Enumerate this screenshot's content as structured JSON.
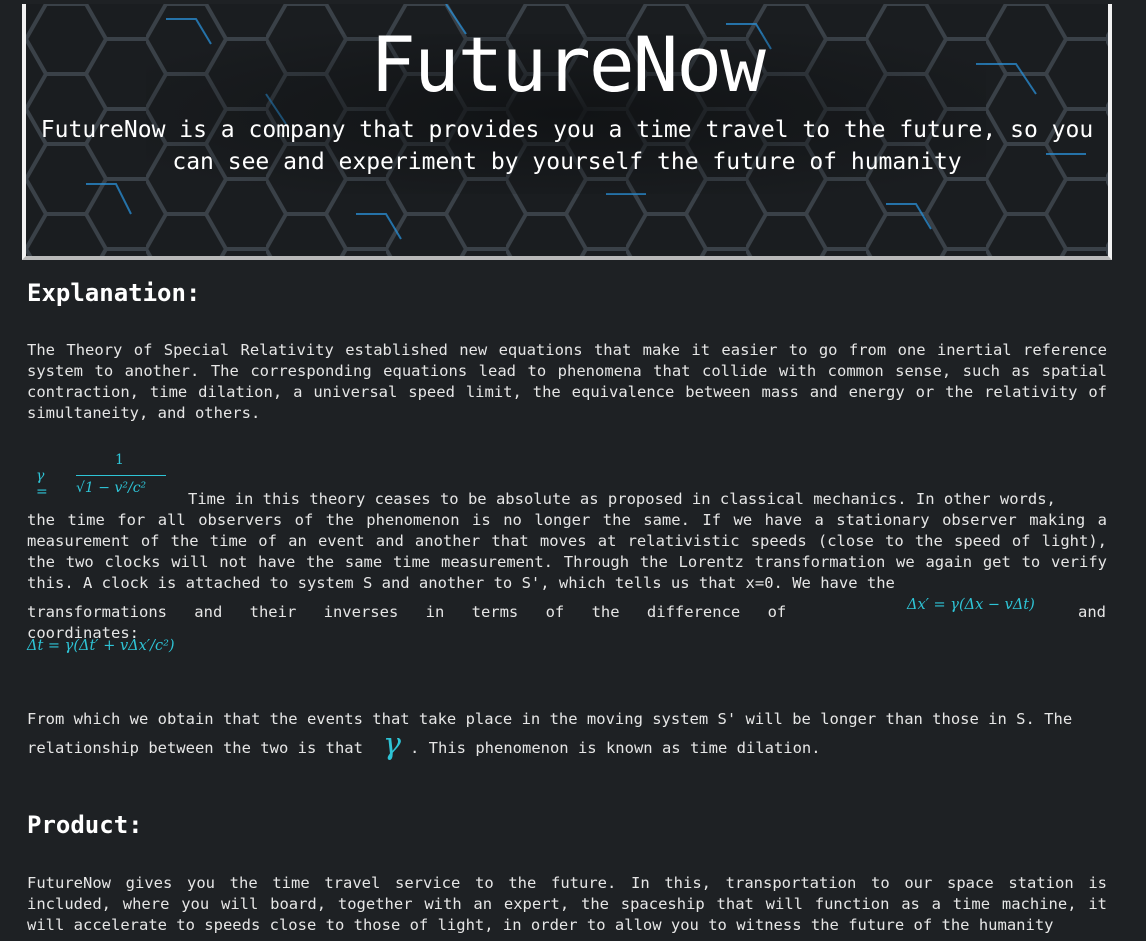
{
  "hero": {
    "title": "FutureNow",
    "subtitle": "FutureNow is a company that provides you a time travel to the future, so you can see and experiment by yourself the future of humanity"
  },
  "explanation": {
    "heading": "Explanation:",
    "paragraph1": "The Theory of Special Relativity established new equations that make it easier to go from one inertial reference system to another. The corresponding equations lead to phenomena that collide with common sense, such as spatial contraction, time dilation, a universal speed limit, the equivalence between mass and energy or the relativity of simultaneity, and others.",
    "gamma_formula": {
      "lhs": "γ =",
      "numerator": "1",
      "denominator": "√1 − v²/c²"
    },
    "paragraph2_line1": "Time in this theory ceases to be absolute as proposed in classical mechanics. In other words,",
    "paragraph2_rest": "the time for all observers of the phenomenon is no longer the same. If we have a stationary observer making a measurement of the time of an event and another that moves at relativistic speeds (close to the speed of light), the two clocks will not have the same time measurement. Through the Lorentz transformation we again get to verify this. A clock is attached to system S and another to S', which tells us that x=0. We have the",
    "paragraph2_tail": "transformations and their inverses in terms of the difference of coordinates:",
    "equation1": "Δx′ = γ(Δx − vΔt)",
    "and_word": "and",
    "equation2": "Δt = γ(Δt′ + vΔx′/c²)",
    "paragraph3_a": "From which we obtain that the events that take place in the moving system S' will be longer than those in S. The",
    "paragraph3_b": "relationship between the two is that",
    "gamma_symbol": "γ",
    "paragraph3_c": ". This phenomenon is known as time dilation."
  },
  "product": {
    "heading": "Product:",
    "paragraph": "FutureNow gives you the time travel service to the future. In this, transportation to our space station is included, where you will board, together with an expert, the spaceship that will function as a time machine, it will accelerate to speeds close to those of light, in order to allow you to witness the future of the humanity"
  },
  "colors": {
    "background": "#1e2124",
    "text": "#e6e6e6",
    "math": "#2ec4d6",
    "hex_glow": "#2a8fd6"
  }
}
